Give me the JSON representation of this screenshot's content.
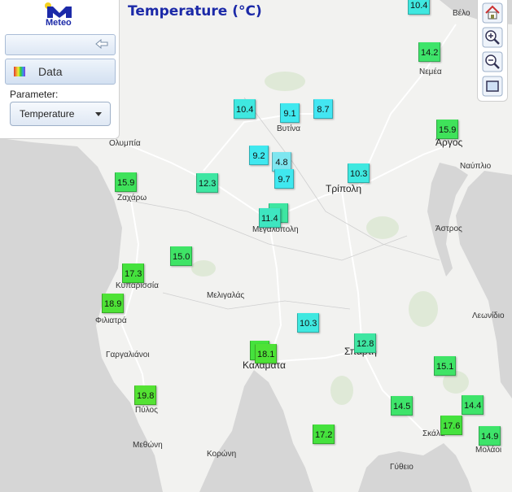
{
  "map_title": "Temperature (°C)",
  "logo_text": "Meteo",
  "sidebar": {
    "data_button": "Data",
    "parameter_label": "Parameter:",
    "parameter_value": "Temperature"
  },
  "places": [
    {
      "name": "Βέλο",
      "size": "small"
    },
    {
      "name": "Νεμέα",
      "size": "small"
    },
    {
      "name": "Ολυμπία",
      "size": "small"
    },
    {
      "name": "Βυτίνα",
      "size": "small"
    },
    {
      "name": "Άργος",
      "size": "big"
    },
    {
      "name": "Ναύπλιο",
      "size": "small"
    },
    {
      "name": "Τρίπολη",
      "size": "big"
    },
    {
      "name": "Ζαχάρω",
      "size": "small"
    },
    {
      "name": "Μεγαλόπολη",
      "size": "small"
    },
    {
      "name": "Άστρος",
      "size": "small"
    },
    {
      "name": "Κυπαρισσία",
      "size": "small"
    },
    {
      "name": "Μελιγαλάς",
      "size": "small"
    },
    {
      "name": "Φιλιατρά",
      "size": "small"
    },
    {
      "name": "Λεωνίδιο",
      "size": "small"
    },
    {
      "name": "Γαργαλιάνοι",
      "size": "small"
    },
    {
      "name": "Σπάρτη",
      "size": "big"
    },
    {
      "name": "Καλαμάτα",
      "size": "big"
    },
    {
      "name": "Πύλος",
      "size": "small"
    },
    {
      "name": "Σκάλα",
      "size": "small"
    },
    {
      "name": "Μεθώνη",
      "size": "small"
    },
    {
      "name": "Κορώνη",
      "size": "small"
    },
    {
      "name": "Μολάοι",
      "size": "small"
    },
    {
      "name": "Γύθειο",
      "size": "small"
    }
  ],
  "stations": [
    {
      "value": "10.4",
      "color": "#3fe8e0"
    },
    {
      "value": "14.2",
      "color": "#3ee46a"
    },
    {
      "value": "10.4",
      "color": "#3fe8e0"
    },
    {
      "value": "9.1",
      "color": "#40e8ef"
    },
    {
      "value": "8.7",
      "color": "#43e6f2"
    },
    {
      "value": "15.9",
      "color": "#3fe25a"
    },
    {
      "value": "9.2",
      "color": "#40e8ef"
    },
    {
      "value": "4.8",
      "color": "#7ee6f0"
    },
    {
      "value": "9.7",
      "color": "#40e8ef"
    },
    {
      "value": "10.3",
      "color": "#3fe8e0"
    },
    {
      "value": "15.9",
      "color": "#3fe25a"
    },
    {
      "value": "12.3",
      "color": "#3ee6a2"
    },
    {
      "value": "",
      "color": "#3ee6a2"
    },
    {
      "value": "11.4",
      "color": "#3ee6c0"
    },
    {
      "value": "15.0",
      "color": "#3fe466"
    },
    {
      "value": "17.3",
      "color": "#45e23d"
    },
    {
      "value": "18.9",
      "color": "#4ee236"
    },
    {
      "value": "10.3",
      "color": "#3fe8e0"
    },
    {
      "value": "12.8",
      "color": "#3ee6a2"
    },
    {
      "value": "",
      "color": "#45e23d"
    },
    {
      "value": "18.1",
      "color": "#4ee236"
    },
    {
      "value": "15.1",
      "color": "#3fe466"
    },
    {
      "value": "19.8",
      "color": "#54e233"
    },
    {
      "value": "14.5",
      "color": "#3ee46a"
    },
    {
      "value": "14.4",
      "color": "#3ee46a"
    },
    {
      "value": "17.6",
      "color": "#45e23d"
    },
    {
      "value": "17.2",
      "color": "#45e23d"
    },
    {
      "value": "14.9",
      "color": "#3ee46a"
    }
  ]
}
